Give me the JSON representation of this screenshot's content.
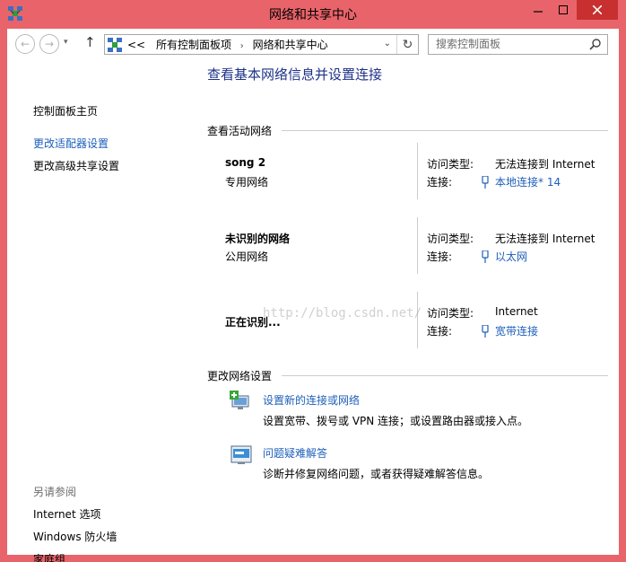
{
  "window": {
    "title": "网络和共享中心"
  },
  "nav": {
    "breadcrumb": [
      "所有控制面板项",
      "网络和共享中心"
    ],
    "breadcrumb_prefix": "<<",
    "search_placeholder": "搜索控制面板"
  },
  "sidebar": {
    "home": "控制面板主页",
    "links": [
      "更改适配器设置",
      "更改高级共享设置"
    ],
    "see_also_heading": "另请参阅",
    "see_also": [
      "Internet 选项",
      "Windows 防火墙",
      "家庭组"
    ]
  },
  "main": {
    "title": "查看基本网络信息并设置连接",
    "active_heading": "查看活动网络",
    "networks": [
      {
        "name": "song  2",
        "type": "专用网络",
        "access_label": "访问类型:",
        "access_value": "无法连接到 Internet",
        "conn_label": "连接:",
        "conn_value": "本地连接* 14"
      },
      {
        "name": "未识别的网络",
        "type": "公用网络",
        "access_label": "访问类型:",
        "access_value": "无法连接到 Internet",
        "conn_label": "连接:",
        "conn_value": "以太网"
      },
      {
        "name": "正在识别...",
        "type": "",
        "access_label": "访问类型:",
        "access_value": "Internet",
        "conn_label": "连接:",
        "conn_value": "宽带连接"
      }
    ],
    "change_heading": "更改网络设置",
    "tasks": [
      {
        "link": "设置新的连接或网络",
        "desc": "设置宽带、拨号或 VPN 连接；或设置路由器或接入点。"
      },
      {
        "link": "问题疑难解答",
        "desc": "诊断并修复网络问题，或者获得疑难解答信息。"
      }
    ],
    "watermark": "http://blog.csdn.net/"
  },
  "colors": {
    "frame": "#e8646a",
    "close_button": "#c7302f",
    "link": "#1e5fba",
    "title": "#1e3287"
  },
  "icons": [
    "app-network-icon",
    "minimize-icon",
    "maximize-icon",
    "close-icon",
    "back-arrow-icon",
    "forward-arrow-icon",
    "up-arrow-icon",
    "refresh-icon",
    "search-icon",
    "plug-icon",
    "new-connection-icon",
    "troubleshoot-icon"
  ]
}
